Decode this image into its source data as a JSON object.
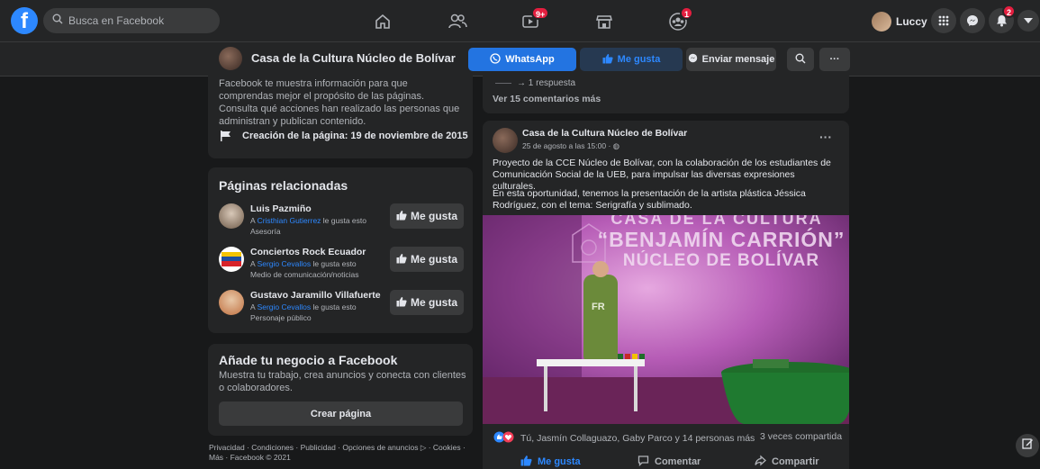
{
  "topbar": {
    "logo": "f",
    "search_placeholder": "Busca en Facebook",
    "badges": {
      "watch": "9+",
      "groups": "1",
      "notifications": "2"
    },
    "profile_name": "Luccy"
  },
  "pagebar": {
    "page_name": "Casa de la Cultura Núcleo de Bolívar",
    "whatsapp_label": "WhatsApp",
    "like_label": "Me gusta",
    "message_label": "Enviar mensaje",
    "more_label": "···"
  },
  "about": {
    "text": "Facebook te muestra información para que comprendas mejor el propósito de las páginas. Consulta qué acciones han realizado las personas que administran y publican contenido.",
    "creation": "Creación de la página: 19 de noviembre de 2015"
  },
  "related": {
    "title": "Páginas relacionadas",
    "like_label": "Me gusta",
    "items": [
      {
        "name": "Luis Pazmiño",
        "friend": "Cristhian Gutierrez",
        "pre": "A ",
        "post": " le gusta esto",
        "category": "Asesoría"
      },
      {
        "name": "Conciertos Rock Ecuador",
        "friend": "Sergio Cevallos",
        "pre": "A ",
        "post": " le gusta esto",
        "category": "Medio de comunicación/noticias"
      },
      {
        "name": "Gustavo Jaramillo Villafuerte",
        "friend": "Sergio Cevallos",
        "pre": "A ",
        "post": " le gusta esto",
        "category": "Personaje público"
      }
    ]
  },
  "business": {
    "title": "Añade tu negocio a Facebook",
    "text": "Muestra tu trabajo, crea anuncios y conecta con clientes o colaboradores.",
    "button": "Crear página"
  },
  "footer": {
    "line1": "Privacidad · Condiciones · Publicidad · Opciones de anuncios ▷ · Cookies ·",
    "line2": "Más · Facebook © 2021"
  },
  "feed": {
    "reply_text": "→ 1 respuesta",
    "more_comments": "Ver 15 comentarios más",
    "post": {
      "author": "Casa de la Cultura Núcleo de Bolívar",
      "date": "25 de agosto a las 15:00 · ◍",
      "paragraph1": "Proyecto de la CCE Núcleo de Bolívar, con la colaboración de los estudiantes de Comunicación Social de la UEB,  para impulsar las diversas expresiones culturales.",
      "paragraph2": "En esta oportunidad, tenemos la presentación  de la artista plástica Jéssica Rodríguez, con el tema: Serigrafía y sublimado.",
      "image_text": {
        "line1": "CASA DE LA CULTURA",
        "line2": "“BENJAMÍN CARRIÓN”",
        "line3": "NÚCLEO DE BOLÍVAR",
        "shirt": "FR"
      },
      "reactions_text": "Tú, Jasmín Collaguazo, Gaby Parco y 14 personas más",
      "shares_text": "3 veces compartida",
      "actions": {
        "like": "Me gusta",
        "comment": "Comentar",
        "share": "Compartir"
      }
    }
  },
  "colors": {
    "background": "#18191a",
    "surface": "#242526",
    "accent_blue": "#2d88ff",
    "button_blue": "#2374e1",
    "badge_red": "#e41e3f"
  }
}
